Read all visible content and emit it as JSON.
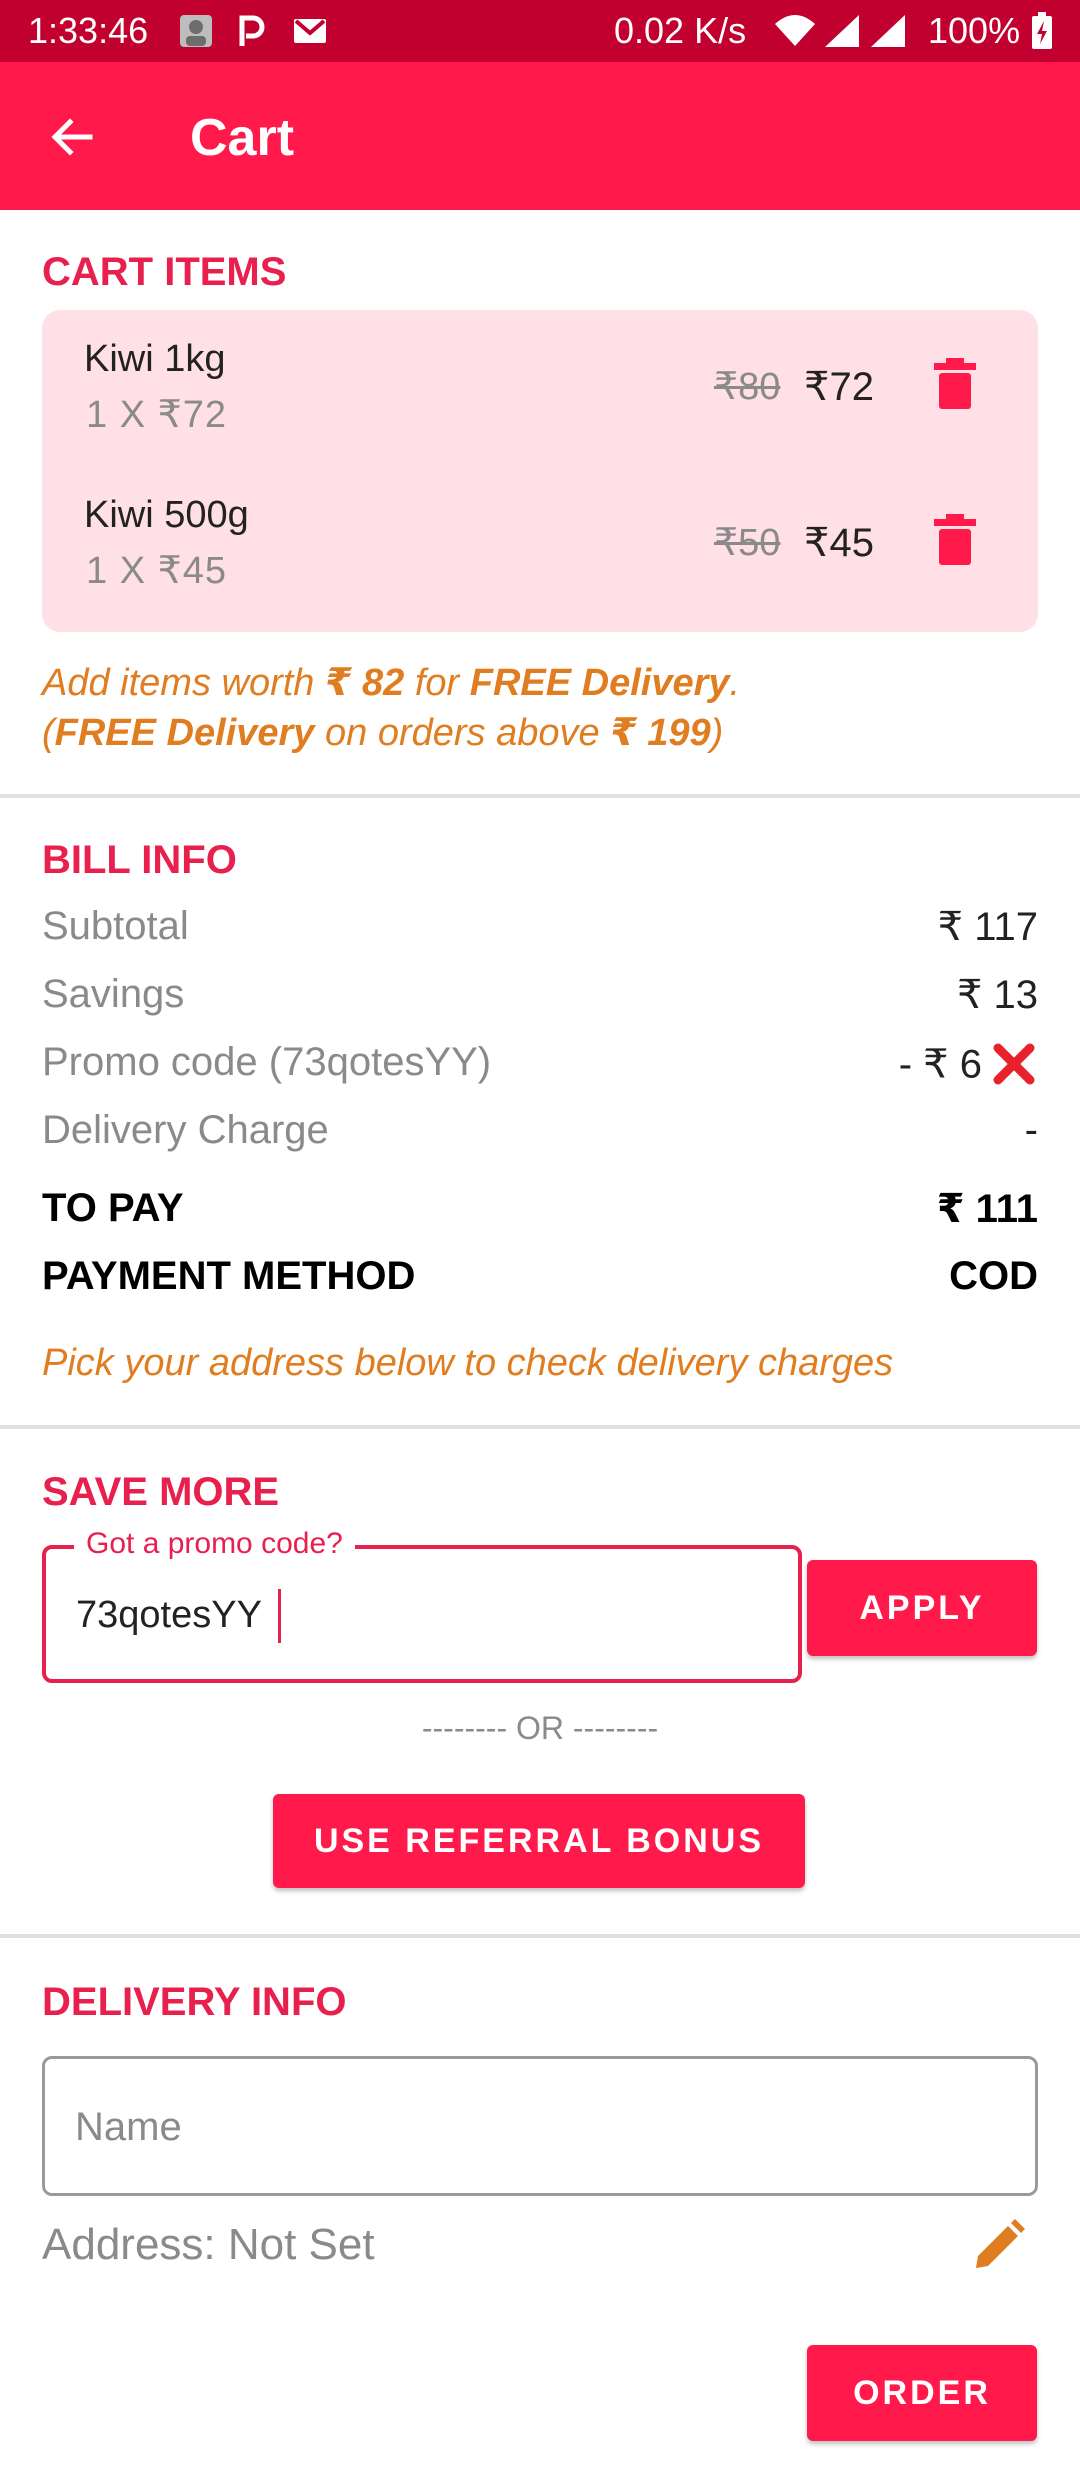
{
  "status_bar": {
    "time": "1:33:46",
    "speed": "0.02 K/s",
    "battery": "100%",
    "icons": [
      "avatar-icon",
      "p-icon",
      "gmail-icon",
      "wifi-icon",
      "signal-icon",
      "signal-icon",
      "battery-icon"
    ]
  },
  "app_bar": {
    "title": "Cart",
    "back_icon": "arrow-back-icon"
  },
  "cart": {
    "section_title": "CART ITEMS",
    "items": [
      {
        "name": "Kiwi 1kg",
        "qty": "1 X ₹72",
        "old_price": "₹80",
        "price": "₹72"
      },
      {
        "name": "Kiwi 500g",
        "qty": "1 X ₹45",
        "old_price": "₹50",
        "price": "₹45"
      }
    ],
    "note": {
      "l1_a": "Add items worth ",
      "l1_amount": "₹ 82",
      "l1_b": " for ",
      "l1_free": "FREE Delivery",
      "l1_c": ".",
      "l2_open": "(",
      "l2_free": "FREE Delivery",
      "l2_a": " on orders above ",
      "l2_amount": "₹ 199",
      "l2_close": ")"
    }
  },
  "bill": {
    "section_title": "BILL INFO",
    "rows": [
      {
        "label": "Subtotal",
        "value": "₹ 117"
      },
      {
        "label": "Savings",
        "value": "₹ 13"
      },
      {
        "label": "Promo code (73qotesYY)",
        "value": "- ₹ 6"
      },
      {
        "label": "Delivery Charge",
        "value": "-"
      },
      {
        "label": "TO PAY",
        "value": "₹ 111"
      },
      {
        "label": "PAYMENT METHOD",
        "value": "COD"
      }
    ],
    "hint": "Pick your address below to check delivery charges"
  },
  "save_more": {
    "section_title": "SAVE MORE",
    "promo_label": "Got a promo code?",
    "promo_value": "73qotesYY",
    "apply_label": "APPLY",
    "or_text": "-------- OR --------",
    "referral_label": "USE REFERRAL BONUS"
  },
  "delivery": {
    "section_title": "DELIVERY INFO",
    "name_placeholder": "Name",
    "address": "Address: Not Set",
    "order_label": "ORDER"
  },
  "colors": {
    "accent": "#ff1a4b",
    "status_bar": "#c2002f",
    "section_title": "#e8204e",
    "cart_bg": "#ffe0e6",
    "note": "#e07d20"
  }
}
